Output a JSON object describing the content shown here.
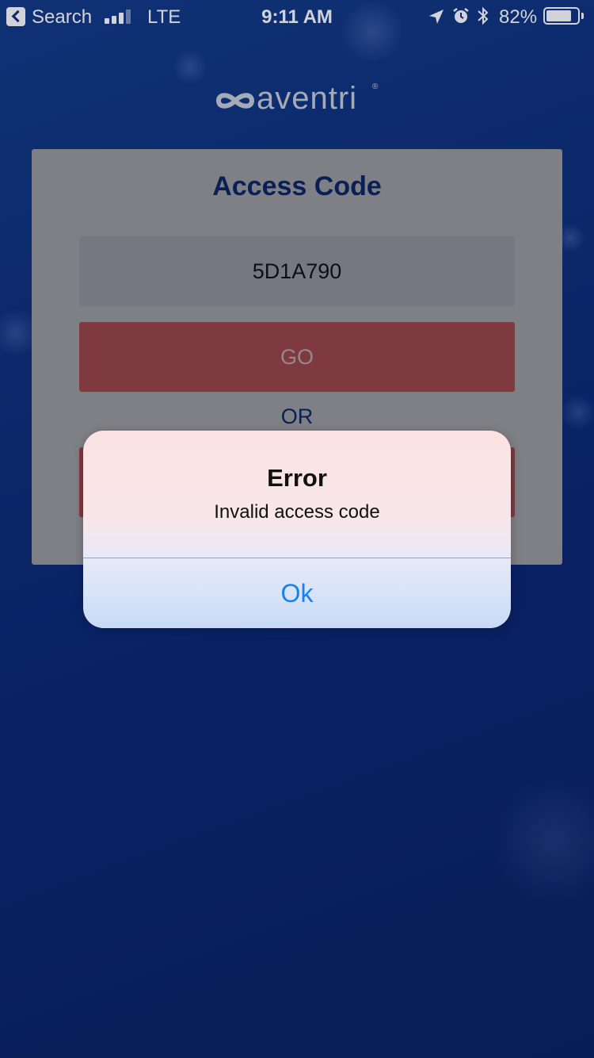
{
  "status_bar": {
    "back_label": "Search",
    "carrier": "LTE",
    "time": "9:11 AM",
    "battery_percent": "82%",
    "battery_level": 0.82,
    "signal_bars_filled": 3,
    "signal_bars_total": 4
  },
  "logo": {
    "text": "aventri",
    "reg_mark": "®"
  },
  "card": {
    "title": "Access Code",
    "code_value": "5D1A790",
    "go_label": "GO",
    "or_label": "OR"
  },
  "alert": {
    "title": "Error",
    "message": "Invalid access code",
    "ok_label": "Ok"
  },
  "colors": {
    "background": "#0e2f78",
    "card": "#9a9a9a",
    "title": "#0b2460",
    "button": "#9b4545",
    "alert_action": "#1a7ff3"
  }
}
